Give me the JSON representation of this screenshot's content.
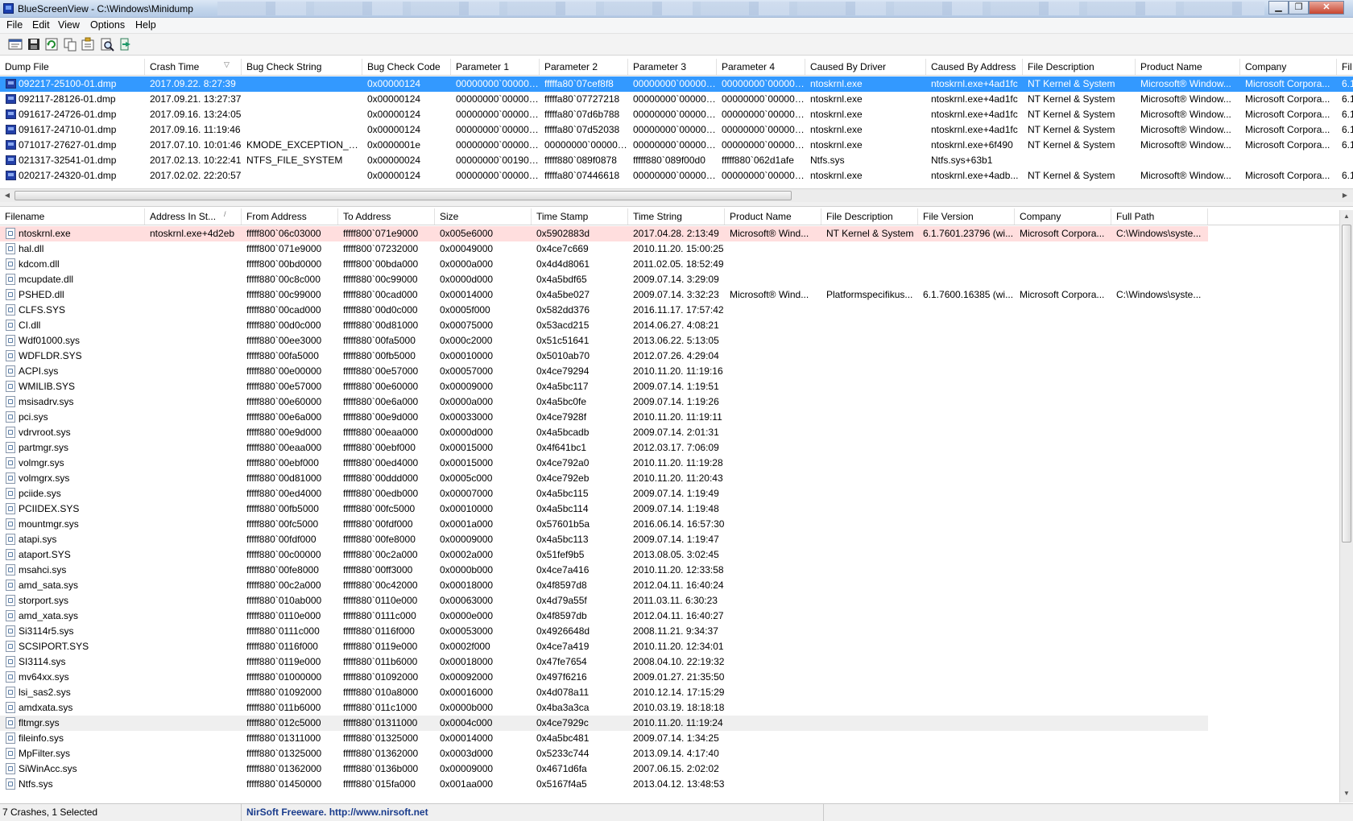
{
  "window": {
    "title": "BlueScreenView  -  C:\\Windows\\Minidump",
    "min_glyph": "▁",
    "max_glyph": "❐",
    "close_glyph": "✕"
  },
  "menu": [
    "File",
    "Edit",
    "View",
    "Options",
    "Help"
  ],
  "toolbar": [
    {
      "name": "html-report-icon"
    },
    {
      "name": "save-icon"
    },
    {
      "name": "refresh-icon"
    },
    {
      "name": "copy-icon"
    },
    {
      "name": "properties-icon"
    },
    {
      "name": "find-icon"
    },
    {
      "name": "exit-icon"
    }
  ],
  "crash_list": {
    "columns": [
      {
        "label": "Dump File",
        "w": 180
      },
      {
        "label": "Crash Time",
        "w": 120,
        "sort": "▽"
      },
      {
        "label": "Bug Check String",
        "w": 150
      },
      {
        "label": "Bug Check Code",
        "w": 110
      },
      {
        "label": "Parameter 1",
        "w": 110
      },
      {
        "label": "Parameter 2",
        "w": 110
      },
      {
        "label": "Parameter 3",
        "w": 110
      },
      {
        "label": "Parameter 4",
        "w": 110
      },
      {
        "label": "Caused By Driver",
        "w": 150
      },
      {
        "label": "Caused By Address",
        "w": 120
      },
      {
        "label": "File Description",
        "w": 140
      },
      {
        "label": "Product Name",
        "w": 130
      },
      {
        "label": "Company",
        "w": 120
      },
      {
        "label": "Fil",
        "w": 30
      }
    ],
    "rows": [
      {
        "selected": true,
        "cells": [
          "092217-25100-01.dmp",
          "2017.09.22. 8:27:39",
          "",
          "0x00000124",
          "00000000`000000...",
          "fffffa80`07cef8f8",
          "00000000`000000...",
          "00000000`000000...",
          "ntoskrnl.exe",
          "ntoskrnl.exe+4ad1fc",
          "NT Kernel & System",
          "Microsoft® Window...",
          "Microsoft Corpora...",
          "6.1"
        ]
      },
      {
        "cells": [
          "092117-28126-01.dmp",
          "2017.09.21. 13:27:37",
          "",
          "0x00000124",
          "00000000`000000...",
          "fffffa80`07727218",
          "00000000`000000...",
          "00000000`000000...",
          "ntoskrnl.exe",
          "ntoskrnl.exe+4ad1fc",
          "NT Kernel & System",
          "Microsoft® Window...",
          "Microsoft Corpora...",
          "6.1"
        ]
      },
      {
        "cells": [
          "091617-24726-01.dmp",
          "2017.09.16. 13:24:05",
          "",
          "0x00000124",
          "00000000`000000...",
          "fffffa80`07d6b788",
          "00000000`000000...",
          "00000000`000000...",
          "ntoskrnl.exe",
          "ntoskrnl.exe+4ad1fc",
          "NT Kernel & System",
          "Microsoft® Window...",
          "Microsoft Corpora...",
          "6.1"
        ]
      },
      {
        "cells": [
          "091617-24710-01.dmp",
          "2017.09.16. 11:19:46",
          "",
          "0x00000124",
          "00000000`000000...",
          "fffffa80`07d52038",
          "00000000`000000...",
          "00000000`000000...",
          "ntoskrnl.exe",
          "ntoskrnl.exe+4ad1fc",
          "NT Kernel & System",
          "Microsoft® Window...",
          "Microsoft Corpora...",
          "6.1"
        ]
      },
      {
        "cells": [
          "071017-27627-01.dmp",
          "2017.07.10. 10:01:46",
          "KMODE_EXCEPTION_N...",
          "0x0000001e",
          "00000000`000000...",
          "00000000`000000...",
          "00000000`000000...",
          "00000000`000000...",
          "ntoskrnl.exe",
          "ntoskrnl.exe+6f490",
          "NT Kernel & System",
          "Microsoft® Window...",
          "Microsoft Corpora...",
          "6.1"
        ]
      },
      {
        "cells": [
          "021317-32541-01.dmp",
          "2017.02.13. 10:22:41",
          "NTFS_FILE_SYSTEM",
          "0x00000024",
          "00000000`001904fb",
          "fffff880`089f0878",
          "fffff880`089f00d0",
          "fffff880`062d1afe",
          "Ntfs.sys",
          "Ntfs.sys+63b1",
          "",
          "",
          "",
          ""
        ]
      },
      {
        "cells": [
          "020217-24320-01.dmp",
          "2017.02.02. 22:20:57",
          "",
          "0x00000124",
          "00000000`000000...",
          "fffffa80`07446618",
          "00000000`000000...",
          "00000000`000000...",
          "ntoskrnl.exe",
          "ntoskrnl.exe+4adb...",
          "NT Kernel & System",
          "Microsoft® Window...",
          "Microsoft Corpora...",
          "6.1"
        ]
      }
    ]
  },
  "scroll": {
    "left": "◀",
    "right": "▶",
    "up": "▲",
    "down": "▼"
  },
  "driver_list": {
    "columns": [
      {
        "label": "Filename",
        "w": 180
      },
      {
        "label": "Address In St...",
        "w": 120,
        "sort": "/"
      },
      {
        "label": "From Address",
        "w": 120
      },
      {
        "label": "To Address",
        "w": 120
      },
      {
        "label": "Size",
        "w": 120
      },
      {
        "label": "Time Stamp",
        "w": 120
      },
      {
        "label": "Time String",
        "w": 120
      },
      {
        "label": "Product Name",
        "w": 120
      },
      {
        "label": "File Description",
        "w": 120
      },
      {
        "label": "File Version",
        "w": 120
      },
      {
        "label": "Company",
        "w": 120
      },
      {
        "label": "Full Path",
        "w": 120
      }
    ],
    "rows": [
      {
        "highlight": "pink",
        "cells": [
          "ntoskrnl.exe",
          "ntoskrnl.exe+4d2eb",
          "fffff800`06c03000",
          "fffff800`071e9000",
          "0x005e6000",
          "0x5902883d",
          "2017.04.28. 2:13:49",
          "Microsoft® Wind...",
          "NT Kernel & System",
          "6.1.7601.23796 (wi...",
          "Microsoft Corpora...",
          "C:\\Windows\\syste..."
        ]
      },
      {
        "cells": [
          "hal.dll",
          "",
          "fffff800`071e9000",
          "fffff800`07232000",
          "0x00049000",
          "0x4ce7c669",
          "2010.11.20. 15:00:25",
          "",
          "",
          "",
          "",
          ""
        ]
      },
      {
        "cells": [
          "kdcom.dll",
          "",
          "fffff800`00bd0000",
          "fffff800`00bda000",
          "0x0000a000",
          "0x4d4d8061",
          "2011.02.05. 18:52:49",
          "",
          "",
          "",
          "",
          ""
        ]
      },
      {
        "cells": [
          "mcupdate.dll",
          "",
          "fffff880`00c8c000",
          "fffff880`00c99000",
          "0x0000d000",
          "0x4a5bdf65",
          "2009.07.14. 3:29:09",
          "",
          "",
          "",
          "",
          ""
        ]
      },
      {
        "cells": [
          "PSHED.dll",
          "",
          "fffff880`00c99000",
          "fffff880`00cad000",
          "0x00014000",
          "0x4a5be027",
          "2009.07.14. 3:32:23",
          "Microsoft® Wind...",
          "Platformspecifikus...",
          "6.1.7600.16385 (wi...",
          "Microsoft Corpora...",
          "C:\\Windows\\syste..."
        ]
      },
      {
        "cells": [
          "CLFS.SYS",
          "",
          "fffff880`00cad000",
          "fffff880`00d0c000",
          "0x0005f000",
          "0x582dd376",
          "2016.11.17. 17:57:42",
          "",
          "",
          "",
          "",
          ""
        ]
      },
      {
        "cells": [
          "CI.dll",
          "",
          "fffff880`00d0c000",
          "fffff880`00d81000",
          "0x00075000",
          "0x53acd215",
          "2014.06.27. 4:08:21",
          "",
          "",
          "",
          "",
          ""
        ]
      },
      {
        "cells": [
          "Wdf01000.sys",
          "",
          "fffff880`00ee3000",
          "fffff880`00fa5000",
          "0x000c2000",
          "0x51c51641",
          "2013.06.22. 5:13:05",
          "",
          "",
          "",
          "",
          ""
        ]
      },
      {
        "cells": [
          "WDFLDR.SYS",
          "",
          "fffff880`00fa5000",
          "fffff880`00fb5000",
          "0x00010000",
          "0x5010ab70",
          "2012.07.26. 4:29:04",
          "",
          "",
          "",
          "",
          ""
        ]
      },
      {
        "cells": [
          "ACPI.sys",
          "",
          "fffff880`00e00000",
          "fffff880`00e57000",
          "0x00057000",
          "0x4ce79294",
          "2010.11.20. 11:19:16",
          "",
          "",
          "",
          "",
          ""
        ]
      },
      {
        "cells": [
          "WMILIB.SYS",
          "",
          "fffff880`00e57000",
          "fffff880`00e60000",
          "0x00009000",
          "0x4a5bc117",
          "2009.07.14. 1:19:51",
          "",
          "",
          "",
          "",
          ""
        ]
      },
      {
        "cells": [
          "msisadrv.sys",
          "",
          "fffff880`00e60000",
          "fffff880`00e6a000",
          "0x0000a000",
          "0x4a5bc0fe",
          "2009.07.14. 1:19:26",
          "",
          "",
          "",
          "",
          ""
        ]
      },
      {
        "cells": [
          "pci.sys",
          "",
          "fffff880`00e6a000",
          "fffff880`00e9d000",
          "0x00033000",
          "0x4ce7928f",
          "2010.11.20. 11:19:11",
          "",
          "",
          "",
          "",
          ""
        ]
      },
      {
        "cells": [
          "vdrvroot.sys",
          "",
          "fffff880`00e9d000",
          "fffff880`00eaa000",
          "0x0000d000",
          "0x4a5bcadb",
          "2009.07.14. 2:01:31",
          "",
          "",
          "",
          "",
          ""
        ]
      },
      {
        "cells": [
          "partmgr.sys",
          "",
          "fffff880`00eaa000",
          "fffff880`00ebf000",
          "0x00015000",
          "0x4f641bc1",
          "2012.03.17. 7:06:09",
          "",
          "",
          "",
          "",
          ""
        ]
      },
      {
        "cells": [
          "volmgr.sys",
          "",
          "fffff880`00ebf000",
          "fffff880`00ed4000",
          "0x00015000",
          "0x4ce792a0",
          "2010.11.20. 11:19:28",
          "",
          "",
          "",
          "",
          ""
        ]
      },
      {
        "cells": [
          "volmgrx.sys",
          "",
          "fffff880`00d81000",
          "fffff880`00ddd000",
          "0x0005c000",
          "0x4ce792eb",
          "2010.11.20. 11:20:43",
          "",
          "",
          "",
          "",
          ""
        ]
      },
      {
        "cells": [
          "pciide.sys",
          "",
          "fffff880`00ed4000",
          "fffff880`00edb000",
          "0x00007000",
          "0x4a5bc115",
          "2009.07.14. 1:19:49",
          "",
          "",
          "",
          "",
          ""
        ]
      },
      {
        "cells": [
          "PCIIDEX.SYS",
          "",
          "fffff880`00fb5000",
          "fffff880`00fc5000",
          "0x00010000",
          "0x4a5bc114",
          "2009.07.14. 1:19:48",
          "",
          "",
          "",
          "",
          ""
        ]
      },
      {
        "cells": [
          "mountmgr.sys",
          "",
          "fffff880`00fc5000",
          "fffff880`00fdf000",
          "0x0001a000",
          "0x57601b5a",
          "2016.06.14. 16:57:30",
          "",
          "",
          "",
          "",
          ""
        ]
      },
      {
        "cells": [
          "atapi.sys",
          "",
          "fffff880`00fdf000",
          "fffff880`00fe8000",
          "0x00009000",
          "0x4a5bc113",
          "2009.07.14. 1:19:47",
          "",
          "",
          "",
          "",
          ""
        ]
      },
      {
        "cells": [
          "ataport.SYS",
          "",
          "fffff880`00c00000",
          "fffff880`00c2a000",
          "0x0002a000",
          "0x51fef9b5",
          "2013.08.05. 3:02:45",
          "",
          "",
          "",
          "",
          ""
        ]
      },
      {
        "cells": [
          "msahci.sys",
          "",
          "fffff880`00fe8000",
          "fffff880`00ff3000",
          "0x0000b000",
          "0x4ce7a416",
          "2010.11.20. 12:33:58",
          "",
          "",
          "",
          "",
          ""
        ]
      },
      {
        "cells": [
          "amd_sata.sys",
          "",
          "fffff880`00c2a000",
          "fffff880`00c42000",
          "0x00018000",
          "0x4f8597d8",
          "2012.04.11. 16:40:24",
          "",
          "",
          "",
          "",
          ""
        ]
      },
      {
        "cells": [
          "storport.sys",
          "",
          "fffff880`010ab000",
          "fffff880`0110e000",
          "0x00063000",
          "0x4d79a55f",
          "2011.03.11. 6:30:23",
          "",
          "",
          "",
          "",
          ""
        ]
      },
      {
        "cells": [
          "amd_xata.sys",
          "",
          "fffff880`0110e000",
          "fffff880`0111c000",
          "0x0000e000",
          "0x4f8597db",
          "2012.04.11. 16:40:27",
          "",
          "",
          "",
          "",
          ""
        ]
      },
      {
        "cells": [
          "Si3114r5.sys",
          "",
          "fffff880`0111c000",
          "fffff880`0116f000",
          "0x00053000",
          "0x4926648d",
          "2008.11.21. 9:34:37",
          "",
          "",
          "",
          "",
          ""
        ]
      },
      {
        "cells": [
          "SCSIPORT.SYS",
          "",
          "fffff880`0116f000",
          "fffff880`0119e000",
          "0x0002f000",
          "0x4ce7a419",
          "2010.11.20. 12:34:01",
          "",
          "",
          "",
          "",
          ""
        ]
      },
      {
        "cells": [
          "SI3114.sys",
          "",
          "fffff880`0119e000",
          "fffff880`011b6000",
          "0x00018000",
          "0x47fe7654",
          "2008.04.10. 22:19:32",
          "",
          "",
          "",
          "",
          ""
        ]
      },
      {
        "cells": [
          "mv64xx.sys",
          "",
          "fffff880`01000000",
          "fffff880`01092000",
          "0x00092000",
          "0x497f6216",
          "2009.01.27. 21:35:50",
          "",
          "",
          "",
          "",
          ""
        ]
      },
      {
        "cells": [
          "lsi_sas2.sys",
          "",
          "fffff880`01092000",
          "fffff880`010a8000",
          "0x00016000",
          "0x4d078a11",
          "2010.12.14. 17:15:29",
          "",
          "",
          "",
          "",
          ""
        ]
      },
      {
        "cells": [
          "amdxata.sys",
          "",
          "fffff880`011b6000",
          "fffff880`011c1000",
          "0x0000b000",
          "0x4ba3a3ca",
          "2010.03.19. 18:18:18",
          "",
          "",
          "",
          "",
          ""
        ]
      },
      {
        "highlight": "grey",
        "cells": [
          "fltmgr.sys",
          "",
          "fffff880`012c5000",
          "fffff880`01311000",
          "0x0004c000",
          "0x4ce7929c",
          "2010.11.20. 11:19:24",
          "",
          "",
          "",
          "",
          ""
        ]
      },
      {
        "cells": [
          "fileinfo.sys",
          "",
          "fffff880`01311000",
          "fffff880`01325000",
          "0x00014000",
          "0x4a5bc481",
          "2009.07.14. 1:34:25",
          "",
          "",
          "",
          "",
          ""
        ]
      },
      {
        "cells": [
          "MpFilter.sys",
          "",
          "fffff880`01325000",
          "fffff880`01362000",
          "0x0003d000",
          "0x5233c744",
          "2013.09.14. 4:17:40",
          "",
          "",
          "",
          "",
          ""
        ]
      },
      {
        "cells": [
          "SiWinAcc.sys",
          "",
          "fffff880`01362000",
          "fffff880`0136b000",
          "0x00009000",
          "0x4671d6fa",
          "2007.06.15. 2:02:02",
          "",
          "",
          "",
          "",
          ""
        ]
      },
      {
        "cells": [
          "Ntfs.sys",
          "",
          "fffff880`01450000",
          "fffff880`015fa000",
          "0x001aa000",
          "0x5167f4a5",
          "2013.04.12. 13:48:53",
          "",
          "",
          "",
          "",
          ""
        ]
      }
    ]
  },
  "status": {
    "count": "7 Crashes, 1 Selected",
    "credit": "NirSoft Freeware.  http://www.nirsoft.net"
  }
}
